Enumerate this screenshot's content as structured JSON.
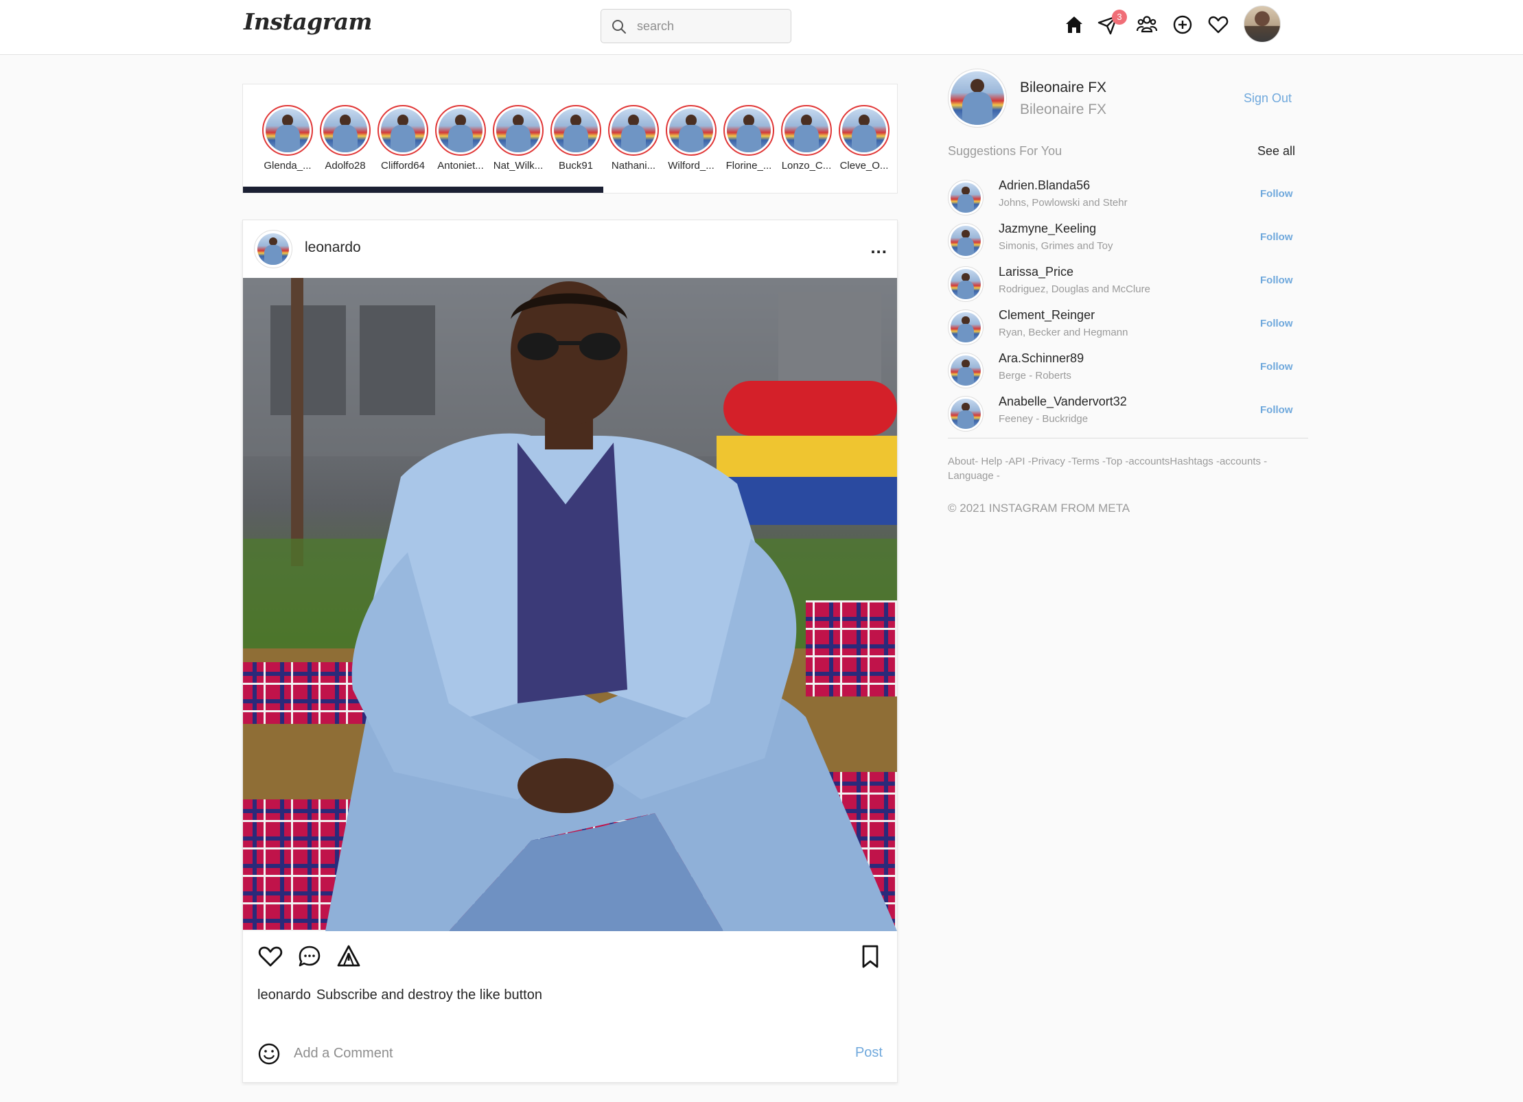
{
  "header": {
    "logo": "Instagram",
    "search_placeholder": "search",
    "messages_badge": "3"
  },
  "stories": [
    {
      "name": "Glenda_..."
    },
    {
      "name": "Adolfo28"
    },
    {
      "name": "Clifford64"
    },
    {
      "name": "Antoniet..."
    },
    {
      "name": "Nat_Wilk..."
    },
    {
      "name": "Buck91"
    },
    {
      "name": "Nathani..."
    },
    {
      "name": "Wilford_..."
    },
    {
      "name": "Florine_..."
    },
    {
      "name": "Lonzo_C..."
    },
    {
      "name": "Cleve_O..."
    }
  ],
  "post": {
    "username": "leonardo",
    "more": "...",
    "caption_user": "leonardo",
    "caption_text": "Subscribe and destroy the like button",
    "comment_placeholder": "Add a Comment",
    "post_label": "Post"
  },
  "profile": {
    "name": "Bileonaire FX",
    "handle": "Bileonaire FX",
    "sign_out": "Sign Out"
  },
  "suggestions": {
    "title": "Suggestions For You",
    "see_all": "See all",
    "follow_label": "Follow",
    "items": [
      {
        "username": "Adrien.Blanda56",
        "sub": "Johns, Powlowski and Stehr"
      },
      {
        "username": "Jazmyne_Keeling",
        "sub": "Simonis, Grimes and Toy"
      },
      {
        "username": "Larissa_Price",
        "sub": "Rodriguez, Douglas and McClure"
      },
      {
        "username": "Clement_Reinger",
        "sub": "Ryan, Becker and Hegmann"
      },
      {
        "username": "Ara.Schinner89",
        "sub": "Berge - Roberts"
      },
      {
        "username": "Anabelle_Vandervort32",
        "sub": "Feeney - Buckridge"
      }
    ]
  },
  "footer": {
    "links": "About- Help -API -Privacy -Terms -Top -accountsHashtags -accounts - Language -",
    "copyright": "© 2021 INSTAGRAM FROM META"
  },
  "colors": {
    "link_blue": "#6fa8dc",
    "story_ring": "#e03636",
    "badge": "#f06e77"
  }
}
